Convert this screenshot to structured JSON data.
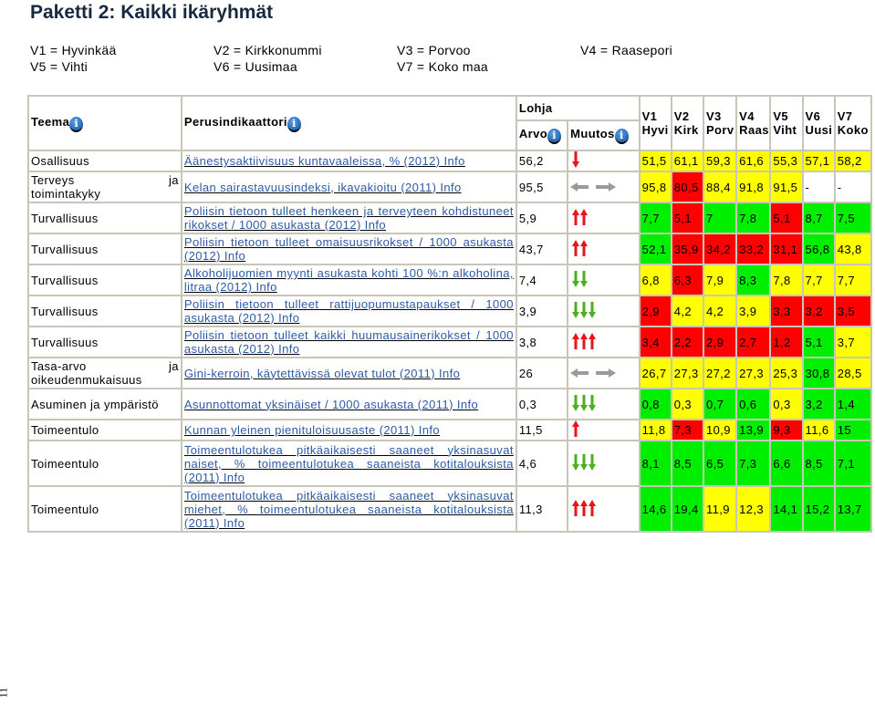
{
  "page": {
    "title": "Paketti 2: Kaikki ikäryhmät",
    "page_number": "11"
  },
  "legend": [
    [
      "V1 = Hyvinkää",
      "V2 = Kirkkonummi",
      "V3 = Porvoo",
      "V4 = Raasepori"
    ],
    [
      "V5 = Vihti",
      "V6 = Uusimaa",
      "V7 = Koko maa",
      ""
    ]
  ],
  "table": {
    "headers": {
      "teema": "Teema",
      "perusindikaattori": "Perusindikaattori",
      "lohja": "Lohja",
      "arvo": "Arvo",
      "muutos": "Muutos",
      "v_cols": [
        {
          "code": "V1",
          "short": "Hyvi"
        },
        {
          "code": "V2",
          "short": "Kirk"
        },
        {
          "code": "V3",
          "short": "Porv"
        },
        {
          "code": "V4",
          "short": "Raas"
        },
        {
          "code": "V5",
          "short": "Viht"
        },
        {
          "code": "V6",
          "short": "Uusi"
        },
        {
          "code": "V7",
          "short": "Koko"
        }
      ]
    },
    "colors": {
      "yellow": "#ffff00",
      "red": "#ff0000",
      "green": "#00ee00",
      "link": "#2d5aa6",
      "arrow_red": "#e8141b",
      "arrow_green": "#4caf1e",
      "arrow_gray": "#9a9a9a"
    },
    "rows": [
      {
        "theme": "Osallisuus",
        "theme_suffix": "",
        "indicator": "Äänestysaktiivisuus kuntavaaleissa, % (2012) Info",
        "value": "56,2",
        "trend": "down-1-red",
        "v": [
          "51,5",
          "61,1",
          "59,3",
          "61,6",
          "55,3",
          "57,1",
          "58,2"
        ],
        "c": [
          "yellow",
          "yellow",
          "yellow",
          "yellow",
          "yellow",
          "yellow",
          "yellow"
        ]
      },
      {
        "theme": "Terveys",
        "theme_suffix": "ja",
        "theme_line2": "toimintakyky",
        "indicator": "Kelan sairastavuusindeksi, ikavakioitu (2011) Info",
        "value": "95,5",
        "trend": "neutral",
        "v": [
          "95,8",
          "80,5",
          "88,4",
          "91,8",
          "91,5",
          "-",
          "-"
        ],
        "c": [
          "yellow",
          "red",
          "yellow",
          "yellow",
          "yellow",
          "none",
          "none"
        ]
      },
      {
        "theme": "Turvallisuus",
        "theme_suffix": "",
        "indicator": "Poliisin tietoon tulleet henkeen ja terveyteen kohdistuneet rikokset / 1000 asukasta (2012) Info",
        "value": "5,9",
        "trend": "up-2-red",
        "v": [
          "7,7",
          "5,1",
          "7",
          "7,8",
          "5,1",
          "8,7",
          "7,5"
        ],
        "c": [
          "green",
          "red",
          "green",
          "green",
          "red",
          "green",
          "green"
        ]
      },
      {
        "theme": "Turvallisuus",
        "theme_suffix": "",
        "indicator": "Poliisin tietoon tulleet omaisuusrikokset / 1000 asukasta (2012) Info",
        "value": "43,7",
        "trend": "up-2-red",
        "v": [
          "52,1",
          "35,9",
          "34,2",
          "33,2",
          "31,1",
          "56,8",
          "43,8"
        ],
        "c": [
          "green",
          "red",
          "red",
          "red",
          "red",
          "green",
          "yellow"
        ]
      },
      {
        "theme": "Turvallisuus",
        "theme_suffix": "",
        "indicator": "Alkoholijuomien myynti asukasta kohti 100 %:n alkoholina, litraa (2012) Info",
        "value": "7,4",
        "trend": "down-2-green",
        "v": [
          "6,8",
          "6,3",
          "7,9",
          "8,3",
          "7,8",
          "7,7",
          "7,7"
        ],
        "c": [
          "yellow",
          "red",
          "yellow",
          "green",
          "yellow",
          "yellow",
          "yellow"
        ]
      },
      {
        "theme": "Turvallisuus",
        "theme_suffix": "",
        "indicator": "Poliisin tietoon tulleet rattijuopumustapaukset / 1000 asukasta (2012) Info",
        "value": "3,9",
        "trend": "down-3-green",
        "v": [
          "2,9",
          "4,2",
          "4,2",
          "3,9",
          "3,3",
          "3,2",
          "3,5"
        ],
        "c": [
          "red",
          "yellow",
          "yellow",
          "yellow",
          "red",
          "red",
          "red"
        ]
      },
      {
        "theme": "Turvallisuus",
        "theme_suffix": "",
        "indicator": "Poliisin tietoon tulleet kaikki huumausainerikokset / 1000 asukasta (2012) Info",
        "value": "3,8",
        "trend": "up-3-red",
        "v": [
          "3,4",
          "2,2",
          "2,9",
          "2,7",
          "1,2",
          "5,1",
          "3,7"
        ],
        "c": [
          "red",
          "red",
          "red",
          "red",
          "red",
          "green",
          "yellow"
        ]
      },
      {
        "theme": "Tasa-arvo",
        "theme_suffix": "ja",
        "theme_line2": "oikeudenmukaisuus",
        "indicator": "Gini-kerroin, käytettävissä olevat tulot (2011) Info",
        "value": "26",
        "trend": "neutral",
        "v": [
          "26,7",
          "27,3",
          "27,2",
          "27,3",
          "25,3",
          "30,8",
          "28,5"
        ],
        "c": [
          "yellow",
          "yellow",
          "yellow",
          "yellow",
          "yellow",
          "green",
          "yellow"
        ]
      },
      {
        "theme": "Asuminen ja ympäristö",
        "theme_suffix": "",
        "indicator": "Asunnottomat yksinäiset / 1000 asukasta (2011) Info",
        "value": "0,3",
        "trend": "down-3-green",
        "v": [
          "0,8",
          "0,3",
          "0,7",
          "0,6",
          "0,3",
          "3,2",
          "1,4"
        ],
        "c": [
          "green",
          "yellow",
          "green",
          "green",
          "yellow",
          "green",
          "green"
        ]
      },
      {
        "theme": "Toimeentulo",
        "theme_suffix": "",
        "indicator": "Kunnan yleinen pienituloisuusaste (2011) Info",
        "value": "11,5",
        "trend": "up-1-red",
        "v": [
          "11,8",
          "7,3",
          "10,9",
          "13,9",
          "9,3",
          "11,6",
          "15"
        ],
        "c": [
          "yellow",
          "red",
          "yellow",
          "green",
          "red",
          "yellow",
          "green"
        ]
      },
      {
        "theme": "Toimeentulo",
        "theme_suffix": "",
        "indicator": "Toimeentulotukea pitkäaikaisesti saaneet yksinasuvat naiset, % toimeentulotukea saaneista kotitalouksista (2011) Info",
        "value": "4,6",
        "trend": "down-3-green",
        "v": [
          "8,1",
          "8,5",
          "6,5",
          "7,3",
          "6,6",
          "8,5",
          "7,1"
        ],
        "c": [
          "green",
          "green",
          "green",
          "green",
          "green",
          "green",
          "green"
        ]
      },
      {
        "theme": "Toimeentulo",
        "theme_suffix": "",
        "indicator": "Toimeentulotukea pitkäaikaisesti saaneet yksinasuvat miehet, % toimeentulotukea saaneista kotitalouksista (2011) Info",
        "value": "11,3",
        "trend": "up-3-red",
        "v": [
          "14,6",
          "19,4",
          "11,9",
          "12,3",
          "14,1",
          "15,2",
          "13,7"
        ],
        "c": [
          "green",
          "green",
          "yellow",
          "yellow",
          "green",
          "green",
          "green"
        ]
      }
    ]
  }
}
